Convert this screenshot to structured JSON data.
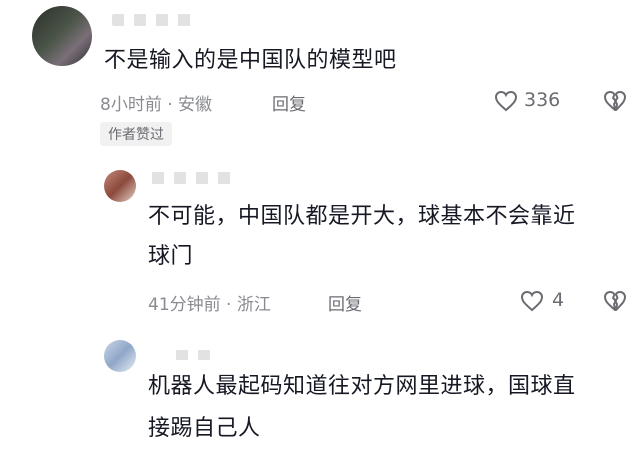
{
  "comments": [
    {
      "text": "不是输入的是中国队的模型吧",
      "meta": "8小时前 · 安徽",
      "reply_label": "回复",
      "likes": "336",
      "badge": "作者赞过"
    },
    {
      "text_line1": "不可能，中国队都是开大，球基本不会靠近",
      "text_line2": "球门",
      "meta": "41分钟前 · 浙江",
      "reply_label": "回复",
      "likes": "4"
    },
    {
      "text_line1": "机器人最起码知道往对方网里进球，国球直",
      "text_line2": "接踢自己人"
    }
  ],
  "icons": {
    "like": "heart-icon",
    "dislike": "broken-heart-icon"
  },
  "colors": {
    "text": "#161823",
    "meta": "#8a8b91",
    "badge_bg": "#f1f1f2"
  }
}
